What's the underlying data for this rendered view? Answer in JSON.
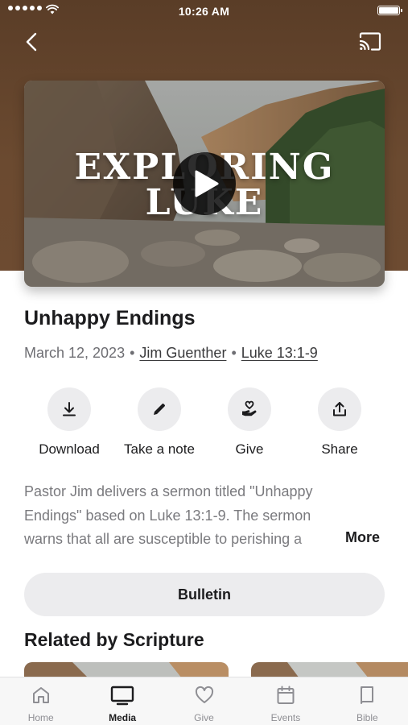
{
  "status_bar": {
    "time": "10:26 AM"
  },
  "media": {
    "series_title_line1": "EXPLORING",
    "series_title_line2": "LUKE",
    "title": "Unhappy Endings",
    "date": "March 12, 2023",
    "speaker": "Jim Guenther",
    "scripture": "Luke 13:1-9",
    "separator": "•"
  },
  "actions": [
    {
      "label": "Download",
      "icon": "download-icon"
    },
    {
      "label": "Take a note",
      "icon": "pencil-icon"
    },
    {
      "label": "Give",
      "icon": "heart-hand-icon"
    },
    {
      "label": "Share",
      "icon": "share-icon"
    }
  ],
  "description": {
    "line1": "Pastor Jim delivers a sermon titled \"Unhappy",
    "line2": "Endings\" based on Luke 13:1-9. The sermon",
    "line3": "warns that all are susceptible to perishing a",
    "more_label": "More"
  },
  "bulletin_label": "Bulletin",
  "related": {
    "title": "Related by Scripture"
  },
  "tabs": [
    {
      "label": "Home",
      "icon": "home-icon",
      "active": false
    },
    {
      "label": "Media",
      "icon": "tv-icon",
      "active": true
    },
    {
      "label": "Give",
      "icon": "heart-icon",
      "active": false
    },
    {
      "label": "Events",
      "icon": "calendar-icon",
      "active": false
    },
    {
      "label": "Bible",
      "icon": "book-icon",
      "active": false
    }
  ],
  "colors": {
    "hero_brown": "#6b4a30",
    "chip_gray": "#ececee",
    "text_primary": "#1c1c1e",
    "text_secondary": "#6e6e73"
  }
}
